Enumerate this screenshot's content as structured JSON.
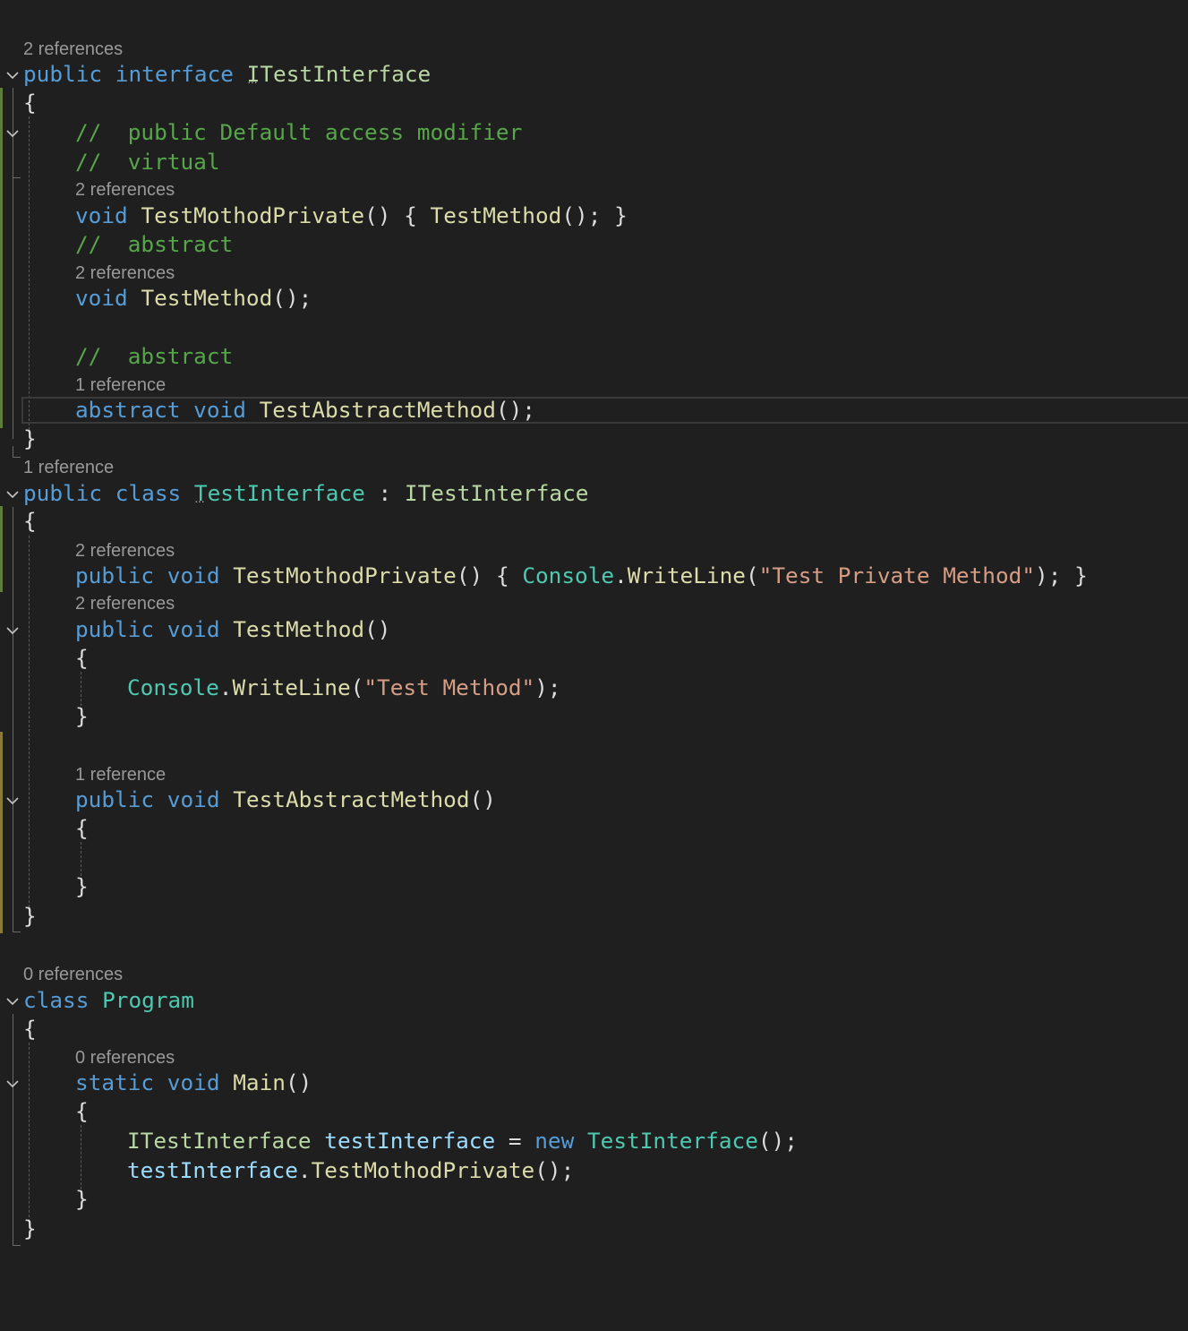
{
  "editor": {
    "codelens": {
      "interface_refs": "2 references",
      "interface_m1_refs": "2 references",
      "interface_m2_refs": "2 references",
      "interface_m3_refs": "1 reference",
      "class_refs": "1 reference",
      "class_m1_refs": "2 references",
      "class_m2_refs": "2 references",
      "class_m3_refs": "1 reference",
      "program_refs": "0 references",
      "main_refs": "0 references"
    },
    "tokens": {
      "public": "public",
      "interface": "interface",
      "class": "class",
      "void": "void",
      "abstract": "abstract",
      "static": "static",
      "new": "new",
      "ITestInterface": "ITestInterface",
      "TestInterface": "TestInterface",
      "Program": "Program",
      "Console": "Console",
      "WriteLine": "WriteLine",
      "TestMothodPrivate": "TestMothodPrivate",
      "TestMethod": "TestMethod",
      "TestAbstractMethod": "TestAbstractMethod",
      "Main": "Main",
      "testInterface": "testInterface",
      "comment_modifier": "//  public Default access modifier",
      "comment_virtual": "//  virtual",
      "comment_abstract": "//  abstract",
      "str_private": "\"Test Private Method\"",
      "str_method": "\"Test Method\"",
      "open_brace": "{",
      "close_brace": "}",
      "parens": "()",
      "semicolon": ";",
      "colon": ":",
      "equals": "=",
      "dot": ".",
      "open_paren": "(",
      "close_paren_semi": ");",
      "empty_body": "{ ",
      "body_tail": "(); }",
      "call_end": "();"
    }
  }
}
